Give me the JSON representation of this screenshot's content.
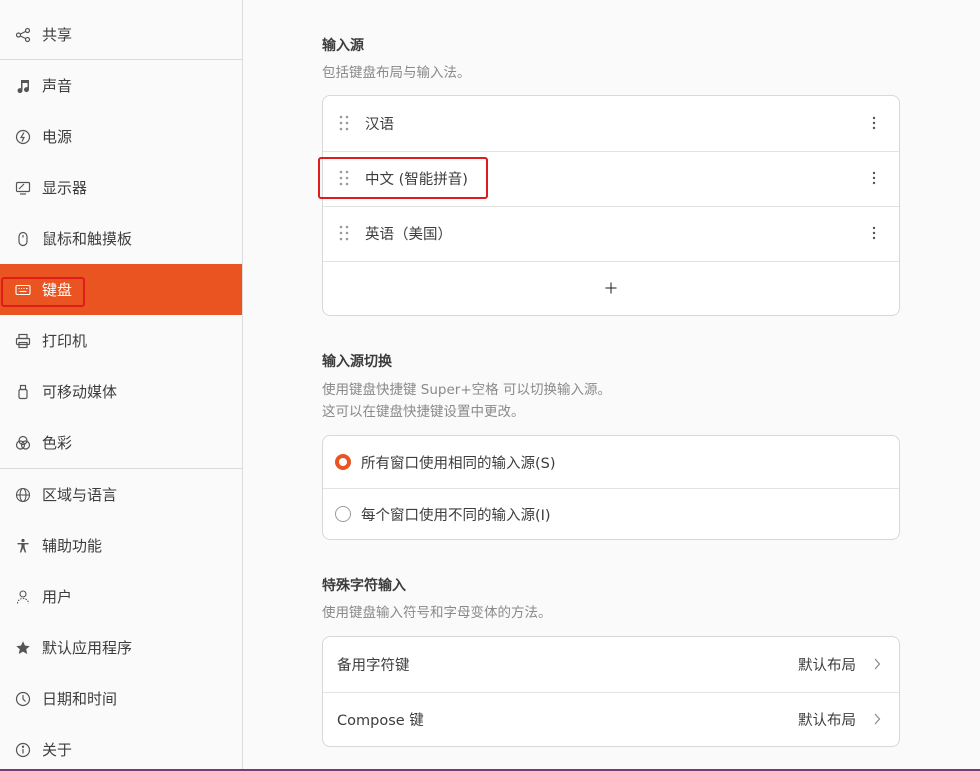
{
  "sidebar": {
    "items": [
      {
        "label": "共享",
        "icon": "share-icon"
      },
      {
        "label": "声音",
        "icon": "music-note-icon"
      },
      {
        "label": "电源",
        "icon": "power-icon"
      },
      {
        "label": "显示器",
        "icon": "display-icon"
      },
      {
        "label": "鼠标和触摸板",
        "icon": "mouse-icon"
      },
      {
        "label": "键盘",
        "icon": "keyboard-icon",
        "active": true
      },
      {
        "label": "打印机",
        "icon": "printer-icon"
      },
      {
        "label": "可移动媒体",
        "icon": "removable-media-icon"
      },
      {
        "label": "色彩",
        "icon": "color-icon"
      },
      {
        "label": "区域与语言",
        "icon": "globe-icon"
      },
      {
        "label": "辅助功能",
        "icon": "accessibility-icon"
      },
      {
        "label": "用户",
        "icon": "user-icon"
      },
      {
        "label": "默认应用程序",
        "icon": "star-icon"
      },
      {
        "label": "日期和时间",
        "icon": "clock-icon"
      },
      {
        "label": "关于",
        "icon": "info-icon"
      }
    ]
  },
  "input_sources": {
    "title": "输入源",
    "description": "包括键盘布局与输入法。",
    "items": [
      {
        "label": "汉语"
      },
      {
        "label": "中文 (智能拼音)"
      },
      {
        "label": "英语（美国）"
      }
    ],
    "add_label": "+"
  },
  "switching": {
    "title": "输入源切换",
    "description_line1": "使用键盘快捷键 Super+空格 可以切换输入源。",
    "description_line2": "这可以在键盘快捷键设置中更改。",
    "options": [
      {
        "label": "所有窗口使用相同的输入源(S)",
        "selected": true
      },
      {
        "label": "每个窗口使用不同的输入源(I)",
        "selected": false
      }
    ]
  },
  "special_chars": {
    "title": "特殊字符输入",
    "description": "使用键盘输入符号和字母变体的方法。",
    "rows": [
      {
        "label": "备用字符键",
        "value": "默认布局"
      },
      {
        "label": "Compose 键",
        "value": "默认布局"
      }
    ]
  },
  "colors": {
    "accent": "#e95420",
    "highlight": "#e01b1b"
  }
}
